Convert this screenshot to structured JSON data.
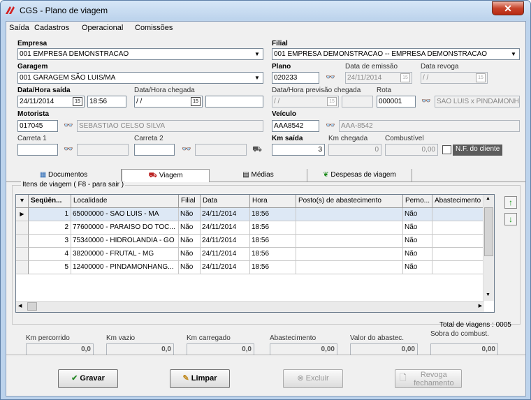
{
  "window": {
    "title": "CGS - Plano de viagem",
    "close": "✕"
  },
  "menu": [
    "Saída",
    "Cadastros",
    "Operacional",
    "Comissões"
  ],
  "empresa": {
    "label": "Empresa",
    "value": "001 EMPRESA DEMONSTRACAO"
  },
  "filial": {
    "label": "Filial",
    "value": "001 EMPRESA DEMONSTRACAO -- EMPRESA DEMONSTRACAO"
  },
  "garagem": {
    "label": "Garagem",
    "value": "001 GARAGEM SÃO LUIS/MA"
  },
  "plano": {
    "label": "Plano",
    "value": "020233"
  },
  "data_emissao": {
    "label": "Data de emissão",
    "value": "24/11/2014"
  },
  "data_revoga": {
    "label": "Data revoga",
    "value": " /  /"
  },
  "saida": {
    "label": "Data/Hora saída",
    "date": "24/11/2014",
    "time": "18:56"
  },
  "chegada": {
    "label": "Data/Hora chegada",
    "date": " /  /",
    "time": ""
  },
  "previsao": {
    "label": "Data/Hora previsão chegada",
    "date": " /  /",
    "time": ""
  },
  "rota": {
    "label": "Rota",
    "code": "000001",
    "desc": "SAO LUIS x PINDAMONH"
  },
  "motorista": {
    "label": "Motorista",
    "code": "017045",
    "name": "SEBASTIAO CELSO SILVA"
  },
  "veiculo": {
    "label": "Veículo",
    "code": "AAA8542",
    "desc": "AAA-8542"
  },
  "carreta1": {
    "label": "Carreta 1"
  },
  "carreta2": {
    "label": "Carreta 2"
  },
  "km": {
    "saida_label": "Km saída",
    "saida": "3",
    "chegada_label": "Km chegada",
    "chegada": "0",
    "comb_label": "Combustível",
    "comb": "0,00",
    "nf_label": "N.F. do cliente"
  },
  "tabs": [
    "Documentos",
    "Viagem",
    "Médias",
    "Despesas de viagem"
  ],
  "group_title": "Itens de viagem ( F8 - para sair )",
  "grid": {
    "headers": [
      "Seqüên...",
      "Localidade",
      "Filial",
      "Data",
      "Hora",
      "Posto(s) de abastecimento",
      "Perno...",
      "Abastecimento"
    ],
    "rows": [
      [
        "1",
        "65000000 - SAO LUIS - MA",
        "Não",
        "24/11/2014",
        "18:56",
        "",
        "Não",
        ""
      ],
      [
        "2",
        "77600000 - PARAISO DO TOC...",
        "Não",
        "24/11/2014",
        "18:56",
        "",
        "Não",
        ""
      ],
      [
        "3",
        "75340000 - HIDROLANDIA - GO",
        "Não",
        "24/11/2014",
        "18:56",
        "",
        "Não",
        ""
      ],
      [
        "4",
        "38200000 - FRUTAL - MG",
        "Não",
        "24/11/2014",
        "18:56",
        "",
        "Não",
        ""
      ],
      [
        "5",
        "12400000 - PINDAMONHANG...",
        "Não",
        "24/11/2014",
        "18:56",
        "",
        "Não",
        ""
      ]
    ]
  },
  "total_viagens": "Total de viagens : 0005",
  "totals": {
    "km_percorrido": {
      "label": "Km percorrido",
      "value": "0,0"
    },
    "km_vazio": {
      "label": "Km vazio",
      "value": "0,0"
    },
    "km_carregado": {
      "label": "Km carregado",
      "value": "0,0"
    },
    "abastecimento": {
      "label": "Abastecimento",
      "value": "0,00"
    },
    "valor_abastec": {
      "label": "Valor do abastec.",
      "value": "0,00"
    },
    "sobra": {
      "label": "Sobra do combust.",
      "value": "0,00"
    }
  },
  "buttons": {
    "gravar": "Gravar",
    "limpar": "Limpar",
    "excluir": "Excluir",
    "revoga1": "Revoga",
    "revoga2": "fechamento"
  }
}
